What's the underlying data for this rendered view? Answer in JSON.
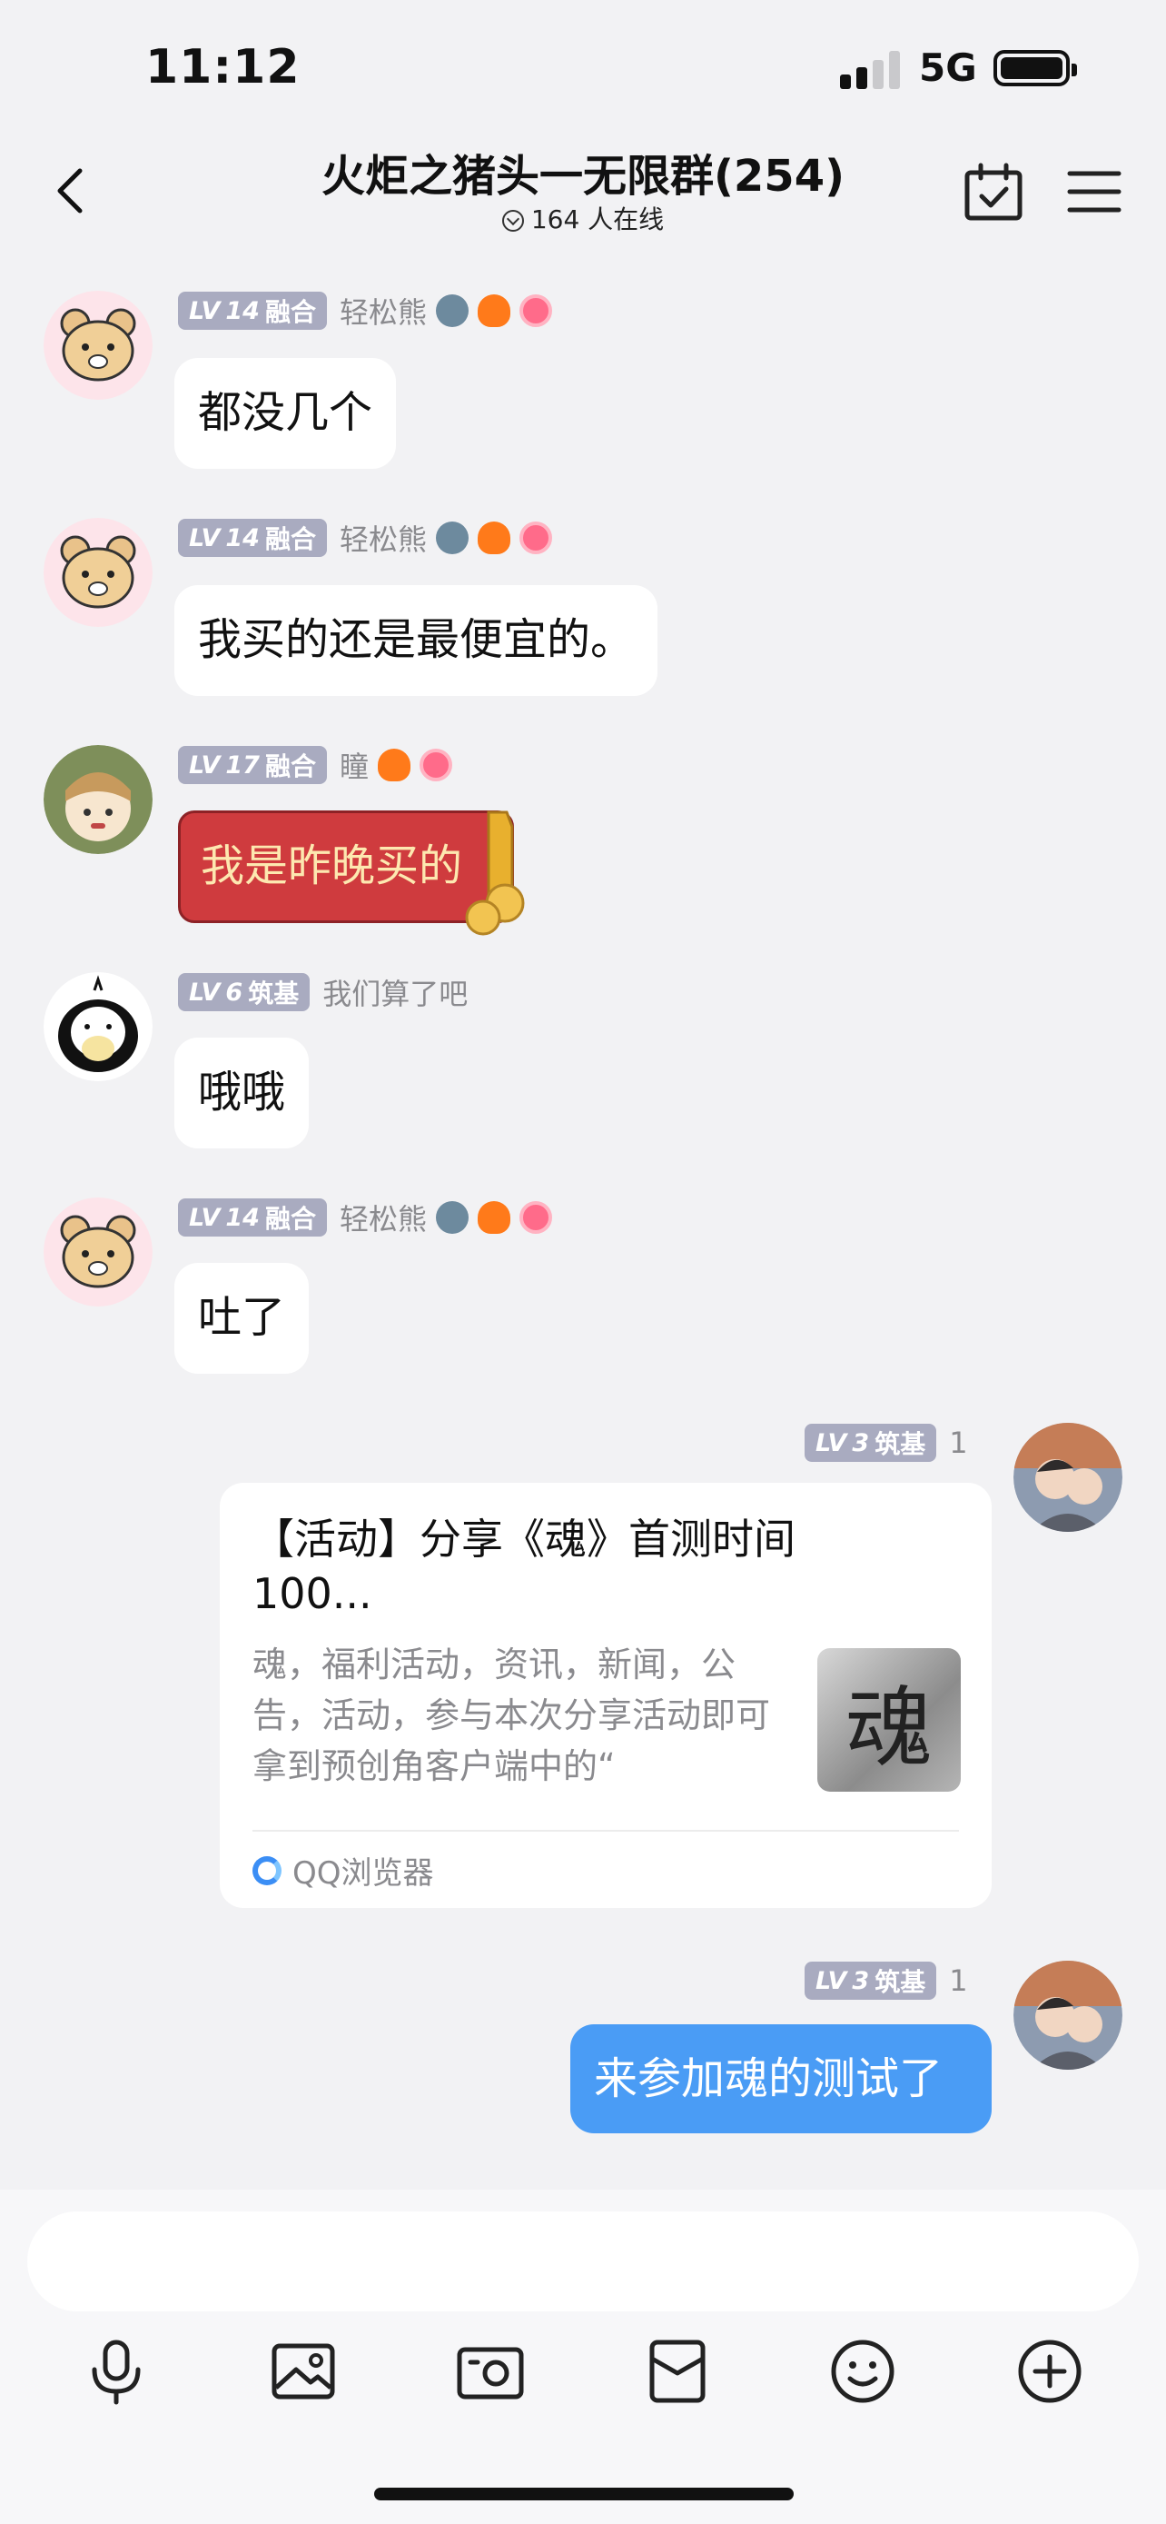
{
  "status_bar": {
    "time": "11:12",
    "network": "5G"
  },
  "header": {
    "title": "火炬之猪头一无限群(254)",
    "online": "164 人在线"
  },
  "messages": [
    {
      "level": "LV",
      "level_num": "14",
      "rank": "融合",
      "name": "轻松熊",
      "text": "都没几个"
    },
    {
      "level": "LV",
      "level_num": "14",
      "rank": "融合",
      "name": "轻松熊",
      "text": "我买的还是最便宜的。"
    },
    {
      "level": "LV",
      "level_num": "17",
      "rank": "融合",
      "name": "瞳",
      "text": "我是昨晚买的"
    },
    {
      "level": "LV",
      "level_num": "6",
      "rank": "筑基",
      "name": "我们算了吧",
      "text": "哦哦"
    },
    {
      "level": "LV",
      "level_num": "14",
      "rank": "融合",
      "name": "轻松熊",
      "text": "吐了"
    }
  ],
  "own_messages": [
    {
      "level": "LV",
      "level_num": "3",
      "rank": "筑基",
      "name": "1"
    },
    {
      "level": "LV",
      "level_num": "3",
      "rank": "筑基",
      "name": "1",
      "text": "来参加魂的测试了"
    }
  ],
  "share_card": {
    "title": "【活动】分享《魂》首测时间100...",
    "description": "魂，福利活动，资讯，新闻，公告，活动，参与本次分享活动即可拿到预创角客户端中的“",
    "thumb_char": "魂",
    "source": "QQ浏览器"
  },
  "toolbar": {
    "icons": [
      "microphone-icon",
      "image-icon",
      "camera-icon",
      "red-packet-icon",
      "emoji-icon",
      "plus-icon"
    ]
  },
  "colors": {
    "background": "#f2f2f4",
    "own_bubble": "#4a9cf5",
    "red_packet": "#cf3b3e",
    "badge": "#a9abc0"
  }
}
